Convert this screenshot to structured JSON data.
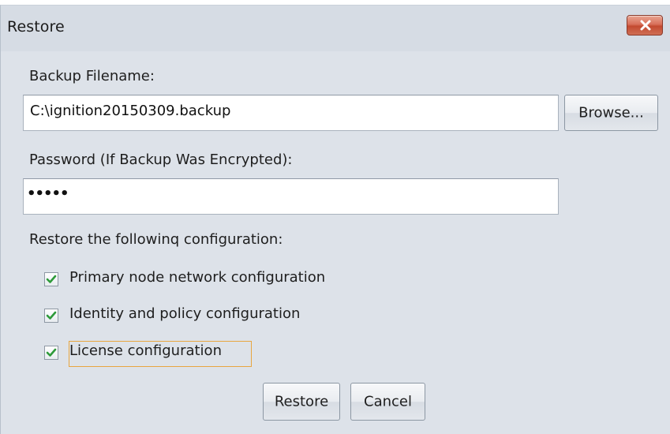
{
  "window": {
    "title": "Restore",
    "close_icon": "close-icon"
  },
  "backup": {
    "label": "Backup Filename:",
    "value": "C:\\ignition20150309.backup",
    "browse_label": "Browse..."
  },
  "password": {
    "label": "Password (If Backup Was Encrypted):",
    "masked_value": "•••••"
  },
  "restore_config": {
    "label": "Restore the followinq configuration:",
    "options": [
      {
        "label": "Primary node network configuration",
        "checked": true
      },
      {
        "label": "Identity and policy configuration",
        "checked": true
      },
      {
        "label": "License configuration",
        "checked": true
      }
    ]
  },
  "actions": {
    "restore_label": "Restore",
    "cancel_label": "Cancel"
  },
  "colors": {
    "window_bg": "#dde2e9",
    "close_button": "#c34a30",
    "check_mark": "#2e9a3a",
    "focus_border": "#e8a640"
  }
}
